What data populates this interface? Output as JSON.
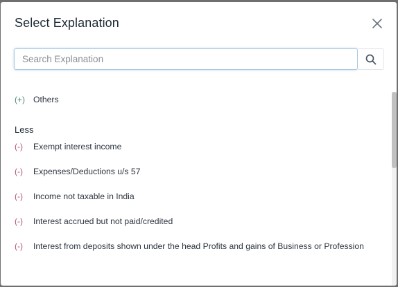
{
  "dialog": {
    "title": "Select Explanation"
  },
  "search": {
    "placeholder": "Search Explanation",
    "value": ""
  },
  "add_items": [
    {
      "sign": "(+)",
      "label": "Others"
    }
  ],
  "less_section": {
    "heading": "Less",
    "items": [
      {
        "sign": "(-)",
        "label": "Exempt interest income"
      },
      {
        "sign": "(-)",
        "label": "Expenses/Deductions u/s 57"
      },
      {
        "sign": "(-)",
        "label": "Income not taxable in India"
      },
      {
        "sign": "(-)",
        "label": "Interest accrued but not paid/credited"
      },
      {
        "sign": "(-)",
        "label": "Interest from deposits shown under the head Profits and gains of Business or Profession"
      }
    ]
  },
  "icons": {
    "close": "close-icon",
    "search": "search-icon"
  },
  "colors": {
    "plus_sign": "#4f8a6a",
    "minus_sign": "#b0566a",
    "input_focus_border": "#a9c9e4"
  }
}
